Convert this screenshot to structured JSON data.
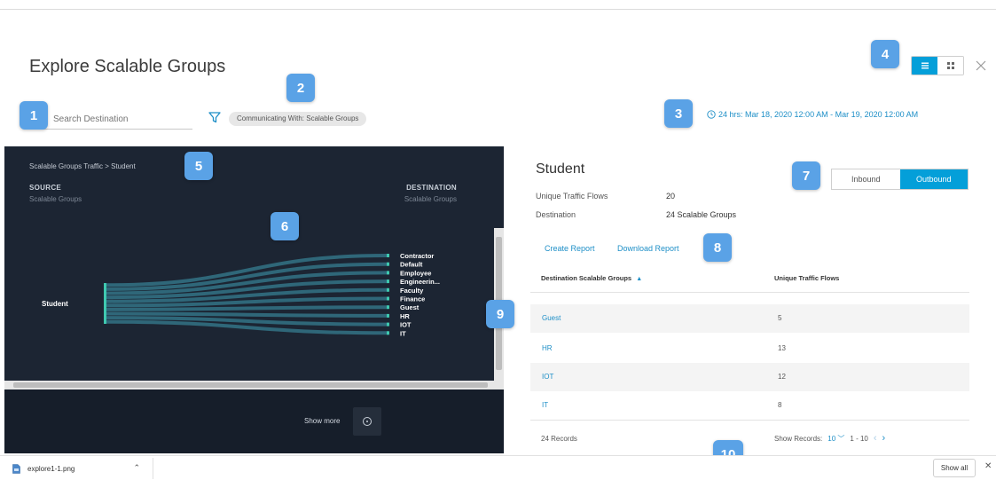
{
  "page": {
    "title": "Explore Scalable Groups"
  },
  "search": {
    "value": "",
    "placeholder": "Search Destination"
  },
  "filter": {
    "chip_label": "Communicating With: Scalable Groups"
  },
  "time_range": {
    "label": "24 hrs:  Mar 18, 2020 12:00 AM - Mar 19, 2020 12:00 AM"
  },
  "view_toggle": {
    "active": "list",
    "options": [
      "list-icon",
      "grid-icon"
    ]
  },
  "sankey": {
    "breadcrumb": "Scalable Groups Traffic > Student",
    "source_heading": "SOURCE",
    "source_sub": "Scalable Groups",
    "dest_heading": "DESTINATION",
    "dest_sub": "Scalable Groups",
    "source_node": "Student",
    "destinations": [
      "Contractor",
      "Default",
      "Employee",
      "Engineerin...",
      "Faculty",
      "Finance",
      "Guest",
      "HR",
      "IOT",
      "IT"
    ],
    "show_more": "Show more"
  },
  "detail": {
    "title": "Student",
    "unique_flows_label": "Unique Traffic Flows",
    "unique_flows_value": "20",
    "destination_label": "Destination",
    "destination_value": "24  Scalable Groups",
    "inbound": "Inbound",
    "outbound": "Outbound",
    "active_direction": "Outbound",
    "create_report": "Create Report",
    "download_report": "Download Report"
  },
  "table": {
    "col1": "Destination Scalable Groups",
    "col1_sort": "▲",
    "col2": "Unique Traffic Flows",
    "rows": [
      {
        "group": "Guest",
        "flows": "5"
      },
      {
        "group": "HR",
        "flows": "13"
      },
      {
        "group": "IOT",
        "flows": "12"
      },
      {
        "group": "IT",
        "flows": "8"
      }
    ],
    "records": "24 Records",
    "show_records_label": "Show Records:",
    "show_records_value": "10",
    "range": "1 - 10"
  },
  "callouts": [
    "1",
    "2",
    "3",
    "4",
    "5",
    "6",
    "7",
    "8",
    "9",
    "10"
  ],
  "download_bar": {
    "file_name": "explore1-1.png",
    "show_all": "Show all"
  },
  "colors": {
    "accent": "#049fd9",
    "link": "#1e8fc7",
    "dark_panel": "#1c2533",
    "callout": "#5aa2e6",
    "sankey_node": "#3fc9b0"
  }
}
